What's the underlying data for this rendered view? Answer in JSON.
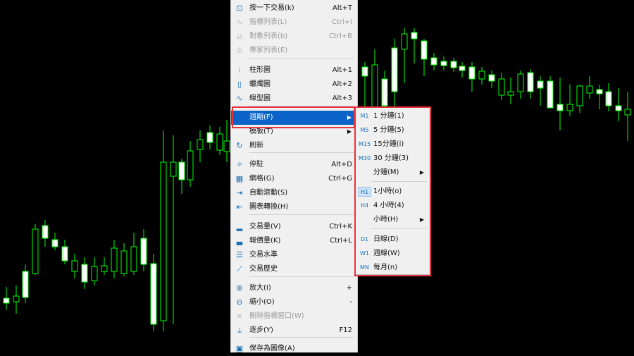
{
  "chart_data": {
    "type": "candlestick",
    "colors": {
      "background": "#000000",
      "up_body": "#000000",
      "down_body": "#ffffff",
      "outline": "#00ff00"
    }
  },
  "context_menu": {
    "items": [
      {
        "icon": "one-click-trading-icon",
        "glyph": "⊡",
        "label": "按一下交易(k)",
        "shortcut": "Alt+T",
        "disabled": false
      },
      {
        "icon": "indicators-list-icon",
        "glyph": "∿",
        "label": "指標列表(L)",
        "shortcut": "Ctrl+I",
        "disabled": true
      },
      {
        "icon": "objects-list-icon",
        "glyph": "⧄",
        "label": "對象列表(b)",
        "shortcut": "Ctrl+B",
        "disabled": true
      },
      {
        "icon": "experts-list-icon",
        "glyph": "♔",
        "label": "專家列表(E)",
        "shortcut": "",
        "disabled": true
      },
      {
        "icon": "bar-chart-icon",
        "glyph": "⫶",
        "label": "柱形圖",
        "shortcut": "Alt+1",
        "disabled": false
      },
      {
        "icon": "candlestick-chart-icon",
        "glyph": "▯",
        "label": "蠟燭圖",
        "shortcut": "Alt+2",
        "disabled": false
      },
      {
        "icon": "line-chart-icon",
        "glyph": "∿",
        "label": "線型圖",
        "shortcut": "Alt+3",
        "disabled": false
      },
      {
        "icon": "",
        "glyph": "",
        "label": "週期(F)",
        "shortcut": "",
        "submenu": true,
        "selected": true
      },
      {
        "icon": "",
        "glyph": "",
        "label": "模板(T)",
        "shortcut": "",
        "submenu": true
      },
      {
        "icon": "refresh-icon",
        "glyph": "↻",
        "label": "刷新",
        "shortcut": ""
      },
      {
        "icon": "pin-icon",
        "glyph": "✧",
        "label": "停駐",
        "shortcut": "Alt+D"
      },
      {
        "icon": "grid-icon",
        "glyph": "▦",
        "label": "網格(G)",
        "shortcut": "Ctrl+G"
      },
      {
        "icon": "auto-scroll-icon",
        "glyph": "⇥",
        "label": "自動滾動(S)",
        "shortcut": ""
      },
      {
        "icon": "chart-shift-icon",
        "glyph": "⇤",
        "label": "圖表轉換(H)",
        "shortcut": ""
      },
      {
        "icon": "volumes-icon",
        "glyph": "▂",
        "label": "交易量(V)",
        "shortcut": "Ctrl+K"
      },
      {
        "icon": "tick-volumes-icon",
        "glyph": "▃",
        "label": "報價量(K)",
        "shortcut": "Ctrl+L"
      },
      {
        "icon": "trade-levels-icon",
        "glyph": "☰",
        "label": "交易水準",
        "shortcut": ""
      },
      {
        "icon": "trade-history-icon",
        "glyph": "⟋",
        "label": "交易歷史",
        "shortcut": ""
      },
      {
        "icon": "zoom-in-icon",
        "glyph": "⊕",
        "label": "放大(I)",
        "shortcut": "+"
      },
      {
        "icon": "zoom-out-icon",
        "glyph": "⊖",
        "label": "縮小(O)",
        "shortcut": "-"
      },
      {
        "icon": "delete-indicator-window-icon",
        "glyph": "✕",
        "label": "刪除指標窗口(W)",
        "shortcut": "",
        "disabled": true
      },
      {
        "icon": "step-by-step-icon",
        "glyph": "⫝",
        "label": "逐步(Y)",
        "shortcut": "F12"
      },
      {
        "icon": "save-as-picture-icon",
        "glyph": "▣",
        "label": "保存為圖像(A)",
        "shortcut": ""
      }
    ]
  },
  "periods_submenu": {
    "items": [
      {
        "tag": "M1",
        "label": "1 分鐘(1)"
      },
      {
        "tag": "M5",
        "label": "5 分鐘(5)"
      },
      {
        "tag": "M15",
        "label": "15分鐘(i)"
      },
      {
        "tag": "M30",
        "label": "30 分鐘(3)"
      },
      {
        "tag": "",
        "label": "分鐘(M)",
        "submenu": true
      },
      {
        "tag": "H1",
        "label": "1小時(o)",
        "highlighted": true
      },
      {
        "tag": "H4",
        "label": "4 小時(4)"
      },
      {
        "tag": "",
        "label": "小時(H)",
        "submenu": true
      },
      {
        "tag": "D1",
        "label": "日線(D)"
      },
      {
        "tag": "W1",
        "label": "週線(W)"
      },
      {
        "tag": "MN",
        "label": "每月(n)"
      }
    ]
  }
}
